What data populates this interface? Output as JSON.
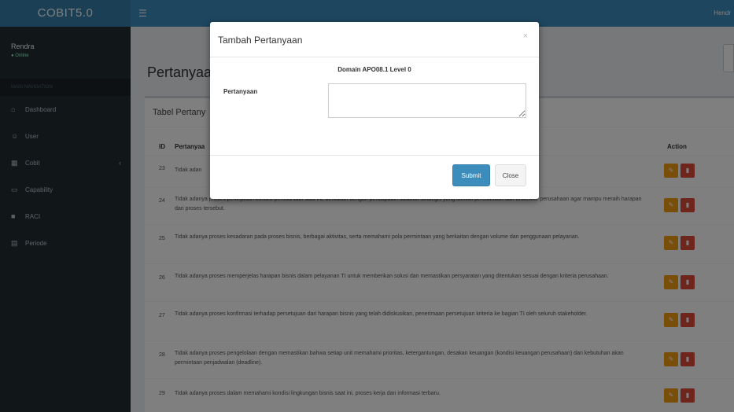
{
  "header": {
    "logo": "COBIT5.0",
    "toggle_icon": "☰",
    "user": "Hendr"
  },
  "sidebar": {
    "user_name": "Rendra",
    "user_status": "● Online",
    "nav_header": "MAIN NAVIGATION",
    "items": [
      {
        "label": "Dashboard",
        "icon": "home-icon",
        "glyph": "⌂"
      },
      {
        "label": "User",
        "icon": "users-icon",
        "glyph": "☺"
      },
      {
        "label": "Cobit",
        "icon": "table-icon",
        "glyph": "▦",
        "caret": "‹"
      },
      {
        "label": "Capability",
        "icon": "laptop-icon",
        "glyph": "▭"
      },
      {
        "label": "RACI",
        "icon": "list-icon",
        "glyph": "■"
      },
      {
        "label": "Periode",
        "icon": "calendar-icon",
        "glyph": "▤"
      }
    ]
  },
  "main": {
    "page_title": "Pertanyaan",
    "box_title": "Tabel Pertany",
    "columns": {
      "id": "ID",
      "question": "Pertanyaa",
      "action": "Action"
    },
    "edit_glyph": "✎",
    "delete_glyph": "▮",
    "rows": [
      {
        "id": "23",
        "text": "Tidak adan"
      },
      {
        "id": "24",
        "text": "Tidak adanya proses peninjauan kondisi perusahaan saat ini, berkaitan dengan pencapaian sasaran strategis yang dimiliki perusahaan dan arsitektur perusahaan agar mampu meraih harapan dari proses tersebut."
      },
      {
        "id": "25",
        "text": "Tidak adanya proses kesadaran pada proses bisnis, berbagai aktivitas, serta memahami pola permintaan yang berkaitan dengan volume dan penggunaan pelayanan."
      },
      {
        "id": "26",
        "text": "Tidak adanya proses memperjelas harapan bisnis dalam pelayanan TI untuk memberikan solusi dan memastikan persyaratan yang ditentukan sesuai dengan kriteria perusahaan."
      },
      {
        "id": "27",
        "text": "Tidak adanya proses konfirmasi terhadap persetujuan dari harapan bisnis yang telah didiskusikan, penerimaan persetujuan kriteria ke bagian TI oleh seluruh stakeholder."
      },
      {
        "id": "28",
        "text": "Tidak adanya proses pengelolaan dengan memastikan bahwa setiap unit memahami prioritas, ketergantungan, desakan keuangan (kondisi keuangan perusahaan) dan kebutuhan akan permintaan penjadwalan (deadline)."
      },
      {
        "id": "29",
        "text": "Tidak adanya proses dalam memahami kondisi lingkungan bisnis saat ini, proses kerja dan informasi terbaru."
      }
    ]
  },
  "modal": {
    "title": "Tambah Pertanyaan",
    "close_icon": "×",
    "domain": "Domain APO08.1 Level 0",
    "field_label": "Pertanyaan",
    "field_value": "",
    "submit_label": "Submit",
    "close_label": "Close"
  }
}
